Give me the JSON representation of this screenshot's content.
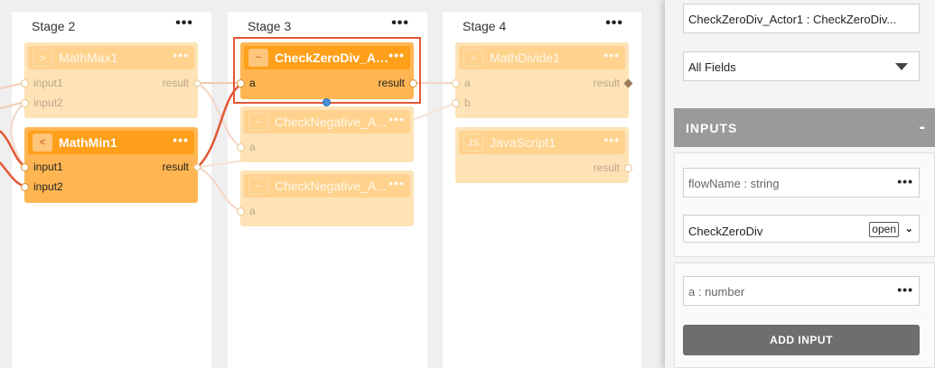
{
  "canvas": {
    "stages": [
      {
        "title": "Stage 2",
        "menu": "•••"
      },
      {
        "title": "Stage 3",
        "menu": "•••"
      },
      {
        "title": "Stage 4",
        "menu": "•••"
      }
    ],
    "nodes": {
      "mathmax": {
        "icon": ">",
        "name": "MathMax1",
        "menu": "•••",
        "in1": "input1",
        "in2": "input2",
        "out": "result"
      },
      "mathmin": {
        "icon": "<",
        "name": "MathMin1",
        "menu": "•••",
        "in1": "input1",
        "in2": "input2",
        "out": "result"
      },
      "checkzero": {
        "icon": "~",
        "name": "CheckZeroDiv_Act...",
        "menu": "•••",
        "in1": "a",
        "out": "result"
      },
      "checkneg1": {
        "icon": "~",
        "name": "CheckNegative_A...",
        "menu": "•••",
        "in1": "a"
      },
      "checkneg2": {
        "icon": "~",
        "name": "CheckNegative_A...",
        "menu": "•••",
        "in1": "a"
      },
      "mathdivide": {
        "icon": "÷",
        "name": "MathDivide1",
        "menu": "•••",
        "in1": "a",
        "in2": "b",
        "out": "result"
      },
      "javascript": {
        "icon": "JS",
        "name": "JavaScript1",
        "menu": "•••",
        "out": "result"
      }
    }
  },
  "panel": {
    "actor_field": "CheckZeroDiv_Actor1 : CheckZeroDiv...",
    "fields_select": "All Fields",
    "inputs_title": "INPUTS",
    "inputs_collapse": "-",
    "input1": {
      "label": "flowName : string",
      "menu": "•••",
      "value": "CheckZeroDiv",
      "open_label": "open",
      "chevron": "⌄"
    },
    "input2": {
      "label": "a : number",
      "menu": "•••"
    },
    "add_input": "ADD INPUT"
  },
  "colors": {
    "node_active": "#ffb652",
    "node_header_active": "#ff9f1a",
    "node_faded": "#fde3b6",
    "selection": "#e25836",
    "wire_active": "#e25836",
    "handle": "#4a90d9"
  }
}
